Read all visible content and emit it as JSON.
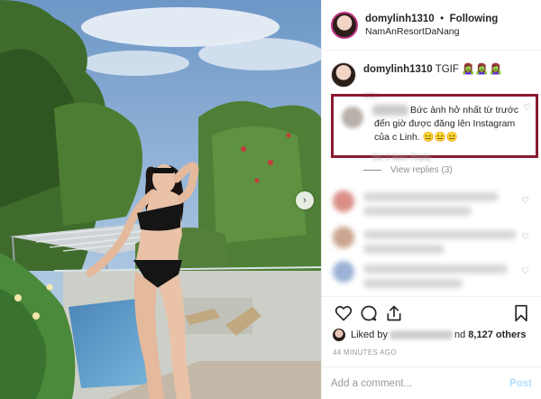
{
  "header": {
    "username": "domylinh1310",
    "separator": "•",
    "follow_state": "Following",
    "location": "NamAnResortDaNang"
  },
  "caption": {
    "username": "domylinh1310",
    "text": "TGIF",
    "emojis": "🧟‍♀️🧟‍♀️🧟‍♀️",
    "time": "44m"
  },
  "highlighted_comment": {
    "text": "Bức ảnh hở nhất từ trước đến giờ được đăng lên Instagram của c Linh. 😐😐😐",
    "meta": "5w  2 likes  Reply"
  },
  "view_replies_label": "View replies (3)",
  "likes": {
    "prefix": "Liked by",
    "suffix_tail": "nd",
    "count_label": "8,127 others"
  },
  "post_time": "44 MINUTES AGO",
  "add_comment": {
    "placeholder": "Add a comment...",
    "post_label": "Post"
  },
  "colors": {
    "highlight_border": "#8b1a2e",
    "post_button": "#b2dffc",
    "story_ring": "#c13584"
  },
  "icons": {
    "like": "heart-icon",
    "comment": "comment-bubble-icon",
    "share": "share-icon",
    "save": "bookmark-icon",
    "next": "chevron-right-icon"
  }
}
